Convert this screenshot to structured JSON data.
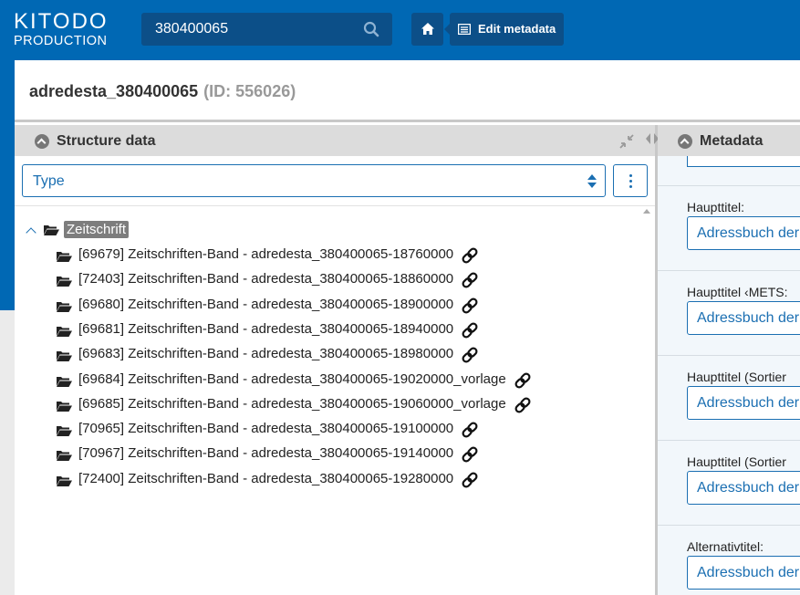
{
  "header": {
    "logo_line1": "KITODO",
    "logo_line2": "PRODUCTION",
    "search_value": "380400065",
    "edit_label": "Edit metadata"
  },
  "title": {
    "name": "adredesta_380400065",
    "id": "(ID: 556026)"
  },
  "structure": {
    "title": "Structure data",
    "type_select": "Type",
    "root": "Zeitschrift",
    "items": [
      "[69679] Zeitschriften-Band - adredesta_380400065-18760000",
      "[72403] Zeitschriften-Band - adredesta_380400065-18860000",
      "[69680] Zeitschriften-Band - adredesta_380400065-18900000",
      "[69681] Zeitschriften-Band - adredesta_380400065-18940000",
      "[69683] Zeitschriften-Band - adredesta_380400065-18980000",
      "[69684] Zeitschriften-Band - adredesta_380400065-19020000_vorlage",
      "[69685] Zeitschriften-Band - adredesta_380400065-19060000_vorlage",
      "[70965] Zeitschriften-Band - adredesta_380400065-19100000",
      "[70967] Zeitschriften-Band - adredesta_380400065-19140000",
      "[72400] Zeitschriften-Band - adredesta_380400065-19280000"
    ]
  },
  "metadata": {
    "title": "Metadata",
    "fields": [
      {
        "label": "Haupttitel:",
        "value": "Adressbuch der"
      },
      {
        "label": "Haupttitel ‹METS:",
        "value": "Adressbuch der"
      },
      {
        "label": "Haupttitel (Sortier",
        "value": "Adressbuch der"
      },
      {
        "label": "Haupttitel (Sortier",
        "value": "Adressbuch der"
      },
      {
        "label": "Alternativtitel:",
        "value": "Adressbuch der"
      }
    ]
  },
  "colors": {
    "brand": "#0068b4",
    "accent": "#1b6fb2",
    "button_bg": "#0c4f88"
  }
}
